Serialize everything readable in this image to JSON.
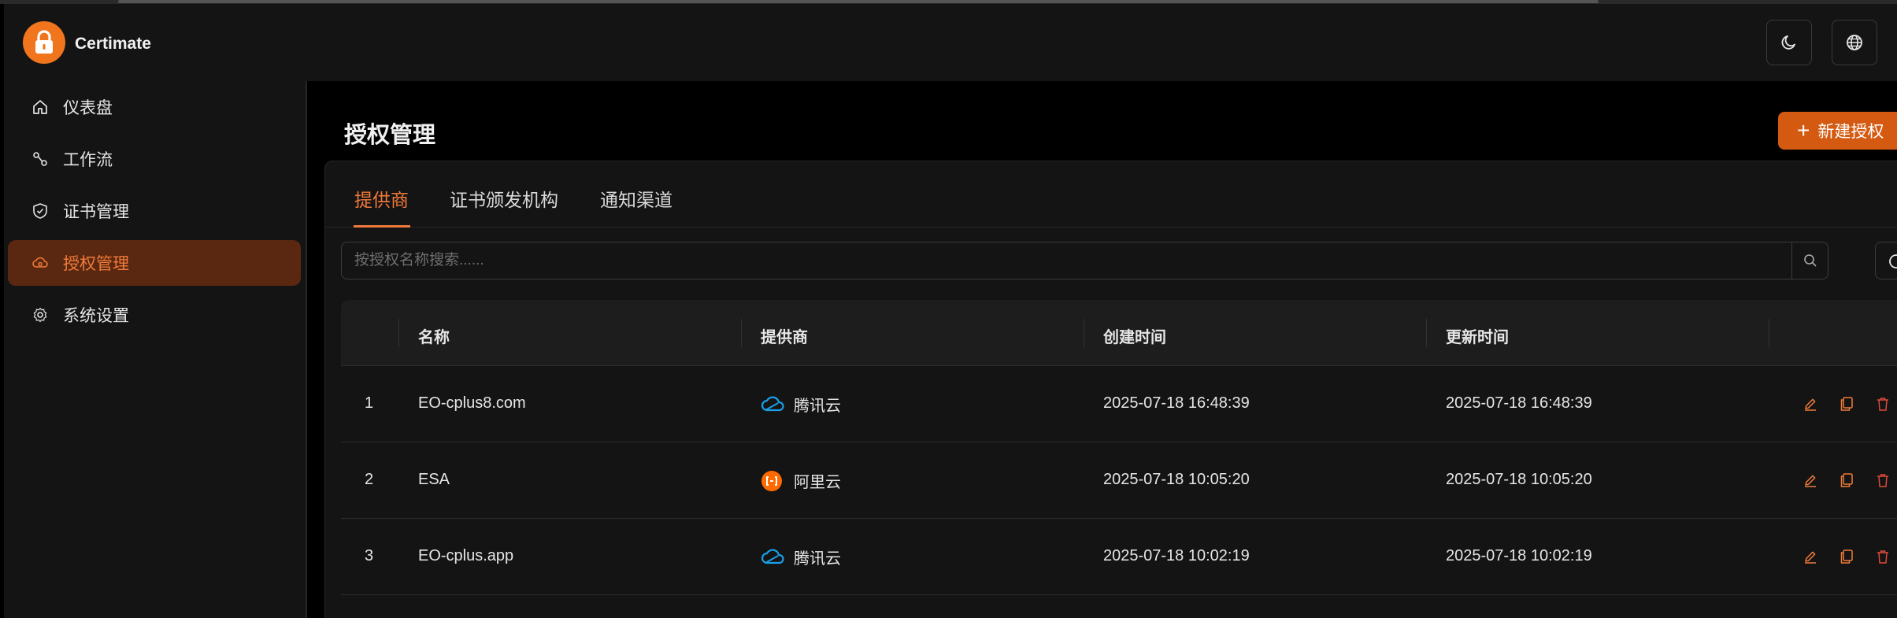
{
  "app": {
    "name": "Certimate"
  },
  "header": {
    "theme_toggle_icon": "moon-icon",
    "language_icon": "globe-icon"
  },
  "sidebar": {
    "items": [
      {
        "label": "仪表盘",
        "icon": "home-icon",
        "active": false
      },
      {
        "label": "工作流",
        "icon": "workflow-icon",
        "active": false
      },
      {
        "label": "证书管理",
        "icon": "shield-check-icon",
        "active": false
      },
      {
        "label": "授权管理",
        "icon": "cloud-key-icon",
        "active": true
      },
      {
        "label": "系统设置",
        "icon": "gear-icon",
        "active": false
      }
    ]
  },
  "page": {
    "title": "授权管理",
    "new_button_label": "新建授权"
  },
  "tabs": [
    {
      "label": "提供商",
      "active": true
    },
    {
      "label": "证书颁发机构",
      "active": false
    },
    {
      "label": "通知渠道",
      "active": false
    }
  ],
  "search": {
    "placeholder": "按授权名称搜索......",
    "value": ""
  },
  "table": {
    "columns": [
      "",
      "名称",
      "提供商",
      "创建时间",
      "更新时间"
    ],
    "rows": [
      {
        "index": "1",
        "name": "EO-cplus8.com",
        "provider": "腾讯云",
        "provider_icon": "tencent-cloud-icon",
        "created": "2025-07-18 16:48:39",
        "updated": "2025-07-18 16:48:39"
      },
      {
        "index": "2",
        "name": "ESA",
        "provider": "阿里云",
        "provider_icon": "aliyun-icon",
        "created": "2025-07-18 10:05:20",
        "updated": "2025-07-18 10:05:20"
      },
      {
        "index": "3",
        "name": "EO-cplus.app",
        "provider": "腾讯云",
        "provider_icon": "tencent-cloud-icon",
        "created": "2025-07-18 10:02:19",
        "updated": "2025-07-18 10:02:19"
      }
    ],
    "row_actions": [
      "edit-icon",
      "copy-icon",
      "delete-icon"
    ]
  },
  "colors": {
    "accent": "#f07a3a",
    "primary_button": "#d45a12",
    "active_nav_bg": "#5a2810",
    "delete": "#e04a3a",
    "tencent": "#1a9fe8",
    "aliyun": "#ff6a00"
  }
}
